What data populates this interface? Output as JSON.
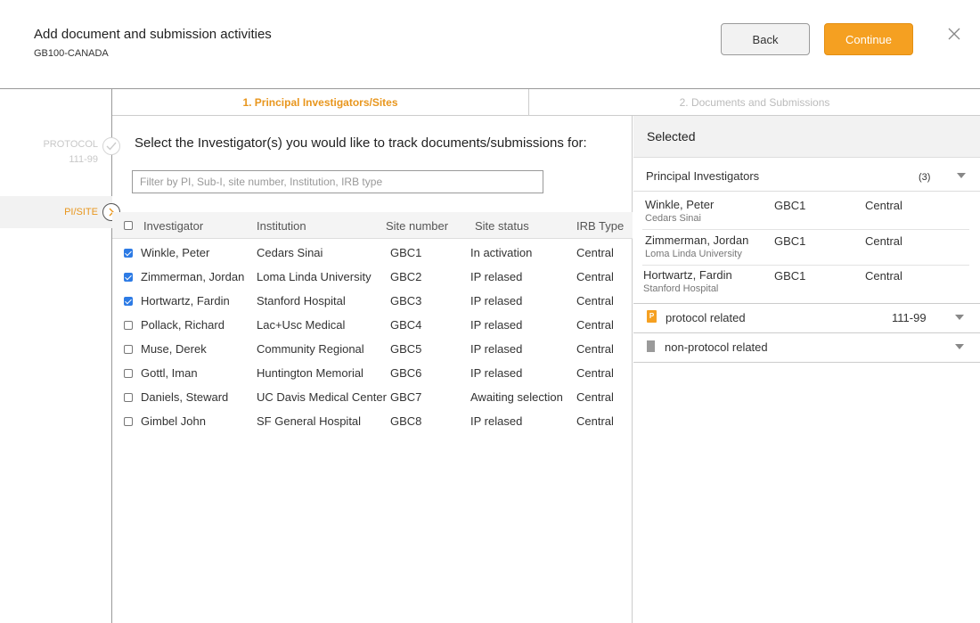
{
  "header": {
    "title": "Add document and submission activities",
    "subtitle": "GB100-CANADA",
    "back_label": "Back",
    "continue_label": "Continue",
    "close_icon": "close-icon"
  },
  "stepper": {
    "step1": {
      "label": "PROTOCOL",
      "value": "111-99",
      "icon": "check-icon"
    },
    "step2": {
      "label": "PI/SITE",
      "icon": "chevron-right-icon"
    }
  },
  "tabs": [
    {
      "label": "1. Principal Investigators/Sites",
      "active": true
    },
    {
      "label": "2. Documents and Submissions",
      "active": false
    }
  ],
  "main": {
    "prompt": "Select the Investigator(s) you would like to track documents/submissions for:",
    "filter_placeholder": "Filter by PI, Sub-I, site number, Institution, IRB type",
    "columns": [
      "Investigator",
      "Institution",
      "Site number",
      "Site status",
      "IRB Type"
    ],
    "rows": [
      {
        "investigator": "Winkle, Peter",
        "institution": "Cedars Sinai",
        "site": "GBC1",
        "status": "In activation",
        "irb": "Central",
        "checked": true
      },
      {
        "investigator": "Zimmerman, Jordan",
        "institution": "Loma Linda University",
        "site": "GBC2",
        "status": "IP relased",
        "irb": "Central",
        "checked": true
      },
      {
        "investigator": "Hortwartz, Fardin",
        "institution": "Stanford Hospital",
        "site": "GBC3",
        "status": "IP relased",
        "irb": "Central",
        "checked": true
      },
      {
        "investigator": "Pollack, Richard",
        "institution": "Lac+Usc Medical",
        "site": "GBC4",
        "status": "IP relased",
        "irb": "Central",
        "checked": false
      },
      {
        "investigator": "Muse, Derek",
        "institution": "Community Regional",
        "site": "GBC5",
        "status": "IP relased",
        "irb": "Central",
        "checked": false
      },
      {
        "investigator": "Gottl, Iman",
        "institution": "Huntington Memorial",
        "site": "GBC6",
        "status": "IP relased",
        "irb": "Central",
        "checked": false
      },
      {
        "investigator": "Daniels, Steward",
        "institution": "UC Davis Medical Center",
        "site": "GBC7",
        "status": "Awaiting selection",
        "irb": "Central",
        "checked": false
      },
      {
        "investigator": "Gimbel John",
        "institution": "SF General Hospital",
        "site": "GBC8",
        "status": "IP relased",
        "irb": "Central",
        "checked": false
      }
    ]
  },
  "selected": {
    "title": "Selected",
    "pi_section": {
      "label": "Principal Investigators",
      "count": "(3)"
    },
    "pis": [
      {
        "name": "Winkle, Peter",
        "institution": "Cedars Sinai",
        "site": "GBC1",
        "irb": "Central"
      },
      {
        "name": "Zimmerman, Jordan",
        "institution": "Loma Linda University",
        "site": "GBC1",
        "irb": "Central"
      },
      {
        "name": "Hortwartz, Fardin",
        "institution": "Stanford Hospital",
        "site": "GBC1",
        "irb": "Central"
      }
    ],
    "protocol_section": {
      "label": "protocol related",
      "value": "111-99",
      "badge": "P"
    },
    "nonprotocol_section": {
      "label": "non-protocol related"
    }
  },
  "colors": {
    "accent": "#f5a021",
    "accent_text": "#e8961d",
    "checkbox": "#2d7be5"
  }
}
